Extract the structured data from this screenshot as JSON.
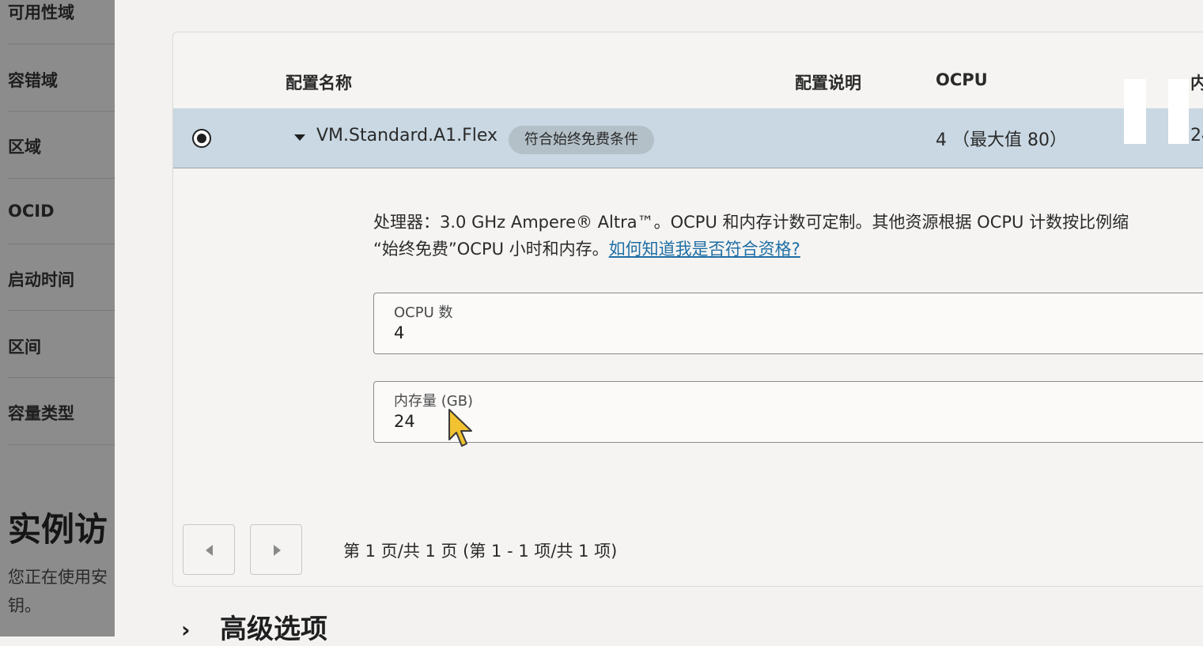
{
  "left_panel": {
    "labels": [
      "可用性域",
      "容错域",
      "区域",
      "OCID",
      "启动时间",
      "区间",
      "容量类型"
    ],
    "section_heading": "实例访",
    "section_desc_line1": "您正在使用安",
    "section_desc_line2": "钥。"
  },
  "table": {
    "columns": {
      "name": "配置名称",
      "desc": "配置说明",
      "ocpu": "OCPU",
      "memory": "内"
    },
    "row": {
      "shape": "VM.Standard.A1.Flex",
      "badge": "符合始终免费条件",
      "ocpu": "4 （最大值 80）",
      "memory": "24"
    }
  },
  "details": {
    "line1": "处理器：3.0 GHz Ampere® Altra™。OCPU 和内存计数可定制。其他资源根据 OCPU 计数按比例缩",
    "line2_prefix": "“始终免费”OCPU 小时和内存。",
    "line2_link": "如何知道我是否符合资格?",
    "ocpu_field": {
      "label": "OCPU 数",
      "value": "4"
    },
    "memory_field": {
      "label": "内存量 (GB)",
      "value": "24"
    }
  },
  "pagination": {
    "text": "第 1 页/共 1 页 (第 1 - 1 项/共 1 项)"
  },
  "advanced": {
    "chevron": "›",
    "title": "高级选项"
  },
  "colors": {
    "selected_row": "#c9d8e3",
    "badge": "#b3c0c8",
    "link": "#1f6fa5",
    "cursor": "#f2c230"
  }
}
